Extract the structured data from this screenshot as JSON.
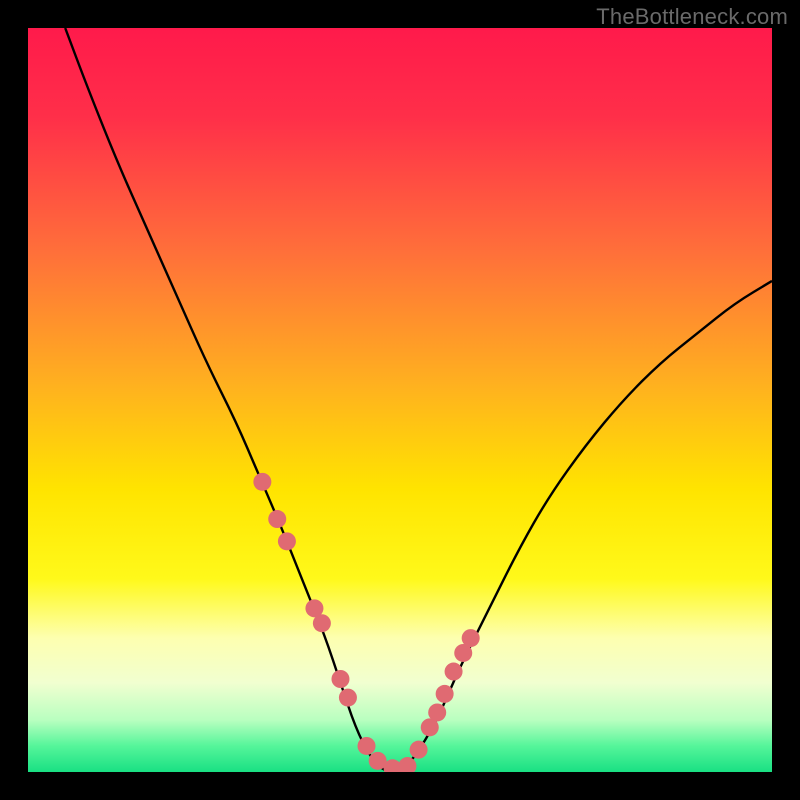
{
  "watermark": "TheBottleneck.com",
  "chart_data": {
    "type": "line",
    "title": "",
    "xlabel": "",
    "ylabel": "",
    "xlim": [
      0,
      100
    ],
    "ylim": [
      0,
      100
    ],
    "curve": {
      "name": "bottleneck-curve",
      "x": [
        5,
        8,
        12,
        16,
        20,
        24,
        28,
        31,
        34,
        36,
        38,
        40,
        42,
        44,
        46,
        48,
        50,
        52,
        55,
        58,
        62,
        66,
        70,
        75,
        80,
        85,
        90,
        95,
        100
      ],
      "y": [
        100,
        92,
        82,
        73,
        64,
        55,
        47,
        40,
        33,
        28,
        23,
        18,
        12,
        6,
        2,
        0,
        0,
        2,
        7,
        14,
        22,
        30,
        37,
        44,
        50,
        55,
        59,
        63,
        66
      ]
    },
    "markers": {
      "name": "highlight-points",
      "color": "#e06a72",
      "radius": 9,
      "x": [
        31.5,
        33.5,
        34.8,
        38.5,
        39.5,
        42.0,
        43.0,
        45.5,
        47.0,
        49.0,
        51.0,
        52.5,
        54.0,
        55.0,
        56.0,
        57.2,
        58.5,
        59.5
      ],
      "y": [
        39.0,
        34.0,
        31.0,
        22.0,
        20.0,
        12.5,
        10.0,
        3.5,
        1.5,
        0.5,
        0.8,
        3.0,
        6.0,
        8.0,
        10.5,
        13.5,
        16.0,
        18.0
      ]
    },
    "background_gradient": {
      "stops": [
        {
          "offset": 0.0,
          "color": "#ff1a4b"
        },
        {
          "offset": 0.12,
          "color": "#ff2f49"
        },
        {
          "offset": 0.3,
          "color": "#ff6f3a"
        },
        {
          "offset": 0.48,
          "color": "#ffb11f"
        },
        {
          "offset": 0.62,
          "color": "#ffe400"
        },
        {
          "offset": 0.74,
          "color": "#fff91a"
        },
        {
          "offset": 0.82,
          "color": "#fdffb0"
        },
        {
          "offset": 0.88,
          "color": "#f1ffd0"
        },
        {
          "offset": 0.93,
          "color": "#b9ffc0"
        },
        {
          "offset": 0.965,
          "color": "#55f59a"
        },
        {
          "offset": 1.0,
          "color": "#19e083"
        }
      ]
    }
  }
}
